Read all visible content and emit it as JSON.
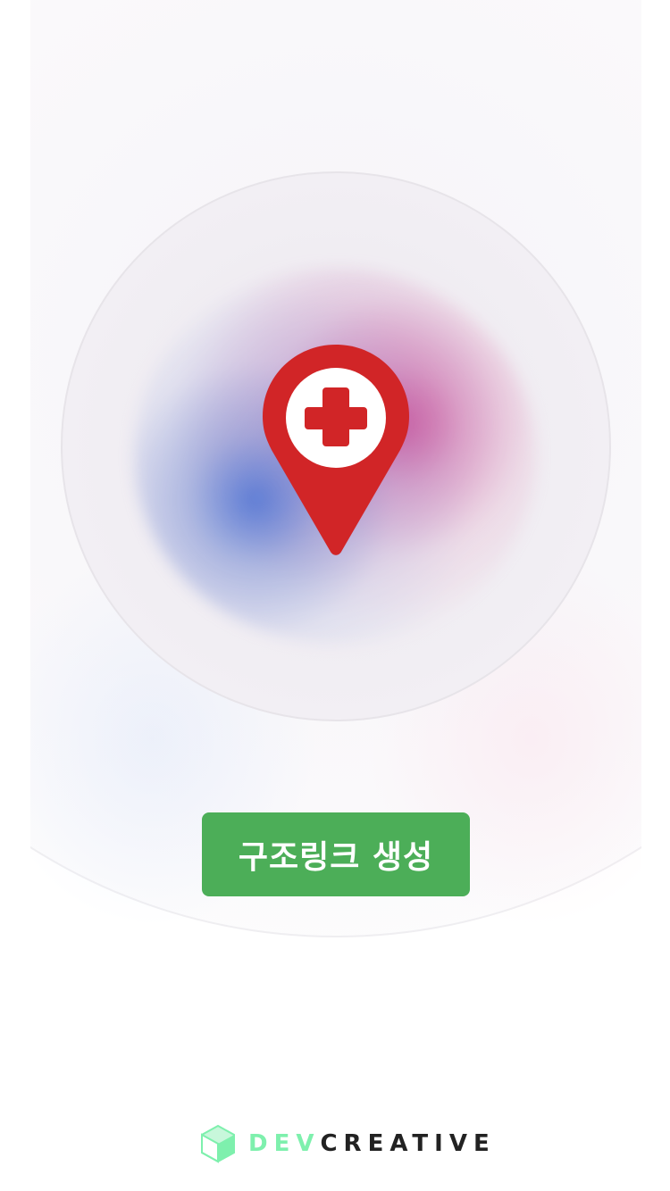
{
  "main": {
    "pin_icon": "medical-location-pin-icon",
    "rescue_button_label": "구조링크 생성"
  },
  "footer": {
    "logo_icon": "cube-logo-icon",
    "brand_part1": "DEV",
    "brand_part2": "CREATIVE"
  },
  "colors": {
    "pin_red": "#d12527",
    "button_green": "#4cae58",
    "brand_mint": "#7ef0ad",
    "brand_dark": "#222222"
  }
}
